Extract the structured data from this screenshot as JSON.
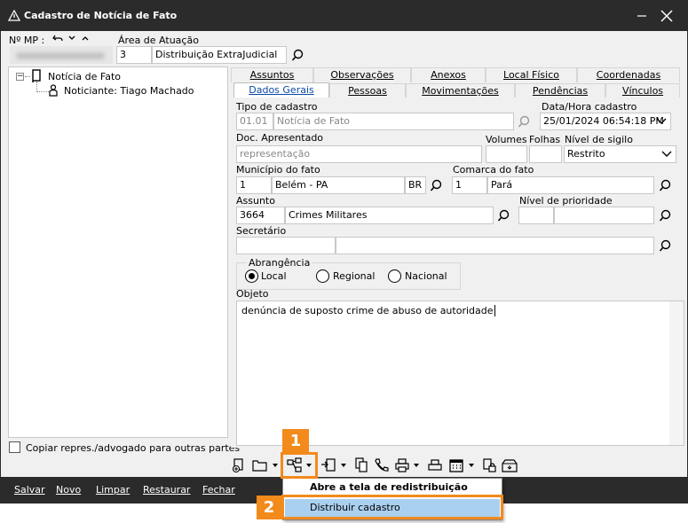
{
  "window": {
    "title": "Cadastro de Notícia de Fato",
    "title_icon": "warning-triangle-icon",
    "colors": {
      "titlebar": "#2b2b2b",
      "accent": "#0a49a6",
      "callout": "#f28a1c",
      "menu_highlight": "#aad0f0"
    }
  },
  "header": {
    "mp_label": "Nº MP :",
    "area_label": "Área de Atuação",
    "area_code": "3",
    "area_name": "Distribuição ExtraJudicial"
  },
  "tree": {
    "root_label": "Notícia de Fato",
    "child_label": "Noticiante: Tiago Machado"
  },
  "tabs": {
    "row1": [
      "Assuntos",
      "Observações",
      "Anexos",
      "Local Físico",
      "Coordenadas"
    ],
    "row2": [
      "Dados Gerais",
      "Pessoas",
      "Movimentações",
      "Pendências",
      "Vínculos"
    ]
  },
  "form": {
    "tipo_label": "Tipo de cadastro",
    "tipo_code": "01.01",
    "tipo_name": "Notícia de Fato",
    "data_label": "Data/Hora cadastro",
    "data_value": "25/01/2024 06:54:18 PM",
    "doc_label": "Doc. Apresentado",
    "doc_value": "representação",
    "volumes_label": "Volumes",
    "folhas_label": "Folhas",
    "sigilo_label": "Nível de sigilo",
    "sigilo_value": "Restrito",
    "municipio_label": "Município do fato",
    "municipio_code": "1",
    "municipio_name": "Belém - PA",
    "municipio_country": "BR",
    "comarca_label": "Comarca do fato",
    "comarca_code": "1",
    "comarca_name": "Pará",
    "assunto_label": "Assunto",
    "assunto_code": "3664",
    "assunto_name": "Crimes Militares",
    "prioridade_label": "Nível de prioridade",
    "secretario_label": "Secretário",
    "abrangencia_label": "Abrangência",
    "abrangencia_options": [
      "Local",
      "Regional",
      "Nacional"
    ],
    "abrangencia_selected": "Local",
    "objeto_label": "Objeto",
    "objeto_value": "denúncia de suposto crime de abuso de autoridade"
  },
  "copiar_label": "Copiar repres./advogado para outras partes",
  "bottom_buttons": [
    "Salvar",
    "Novo",
    "Limpar",
    "Restaurar",
    "Fechar"
  ],
  "dropdown_menu": {
    "items": [
      "Abre a tela de redistribuição",
      "Distribuir cadastro"
    ],
    "highlighted": "Distribuir cadastro"
  },
  "callouts": [
    "1",
    "2"
  ]
}
